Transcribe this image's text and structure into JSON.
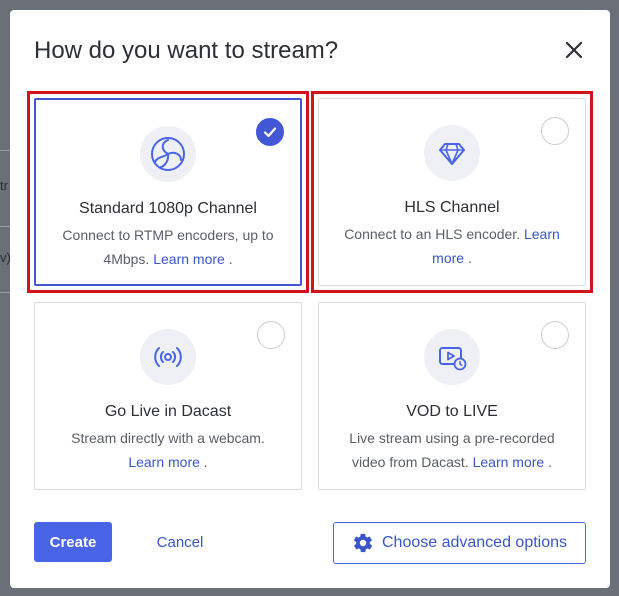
{
  "backdrop": {
    "fragment_1": "tr",
    "fragment_2": "v)"
  },
  "dialog": {
    "title": "How do you want to stream?",
    "close_icon": "close-icon"
  },
  "options": [
    {
      "title": "Standard 1080p Channel",
      "desc": "Connect to RTMP encoders, up to 4Mbps.",
      "link": "Learn more",
      "suffix": ".",
      "icon": "obs-logo-icon",
      "selected": true
    },
    {
      "title": "HLS Channel",
      "desc": "Connect to an HLS encoder.",
      "link": "Learn more",
      "suffix": ".",
      "icon": "diamond-icon",
      "selected": false
    },
    {
      "title": "Go Live in Dacast",
      "desc": "Stream directly with a webcam.",
      "link": "Learn more",
      "suffix": ".",
      "icon": "broadcast-icon",
      "selected": false
    },
    {
      "title": "VOD to LIVE",
      "desc": "Live stream using a pre-recorded video from Dacast.",
      "link": "Learn more",
      "suffix": ".",
      "icon": "video-clock-icon",
      "selected": false
    }
  ],
  "footer": {
    "create_label": "Create",
    "cancel_label": "Cancel",
    "advanced_label": "Choose advanced options",
    "advanced_icon": "gear-icon"
  },
  "colors": {
    "accent": "#4a64e8",
    "link": "#3b55c8",
    "highlight": "#d0131c"
  }
}
